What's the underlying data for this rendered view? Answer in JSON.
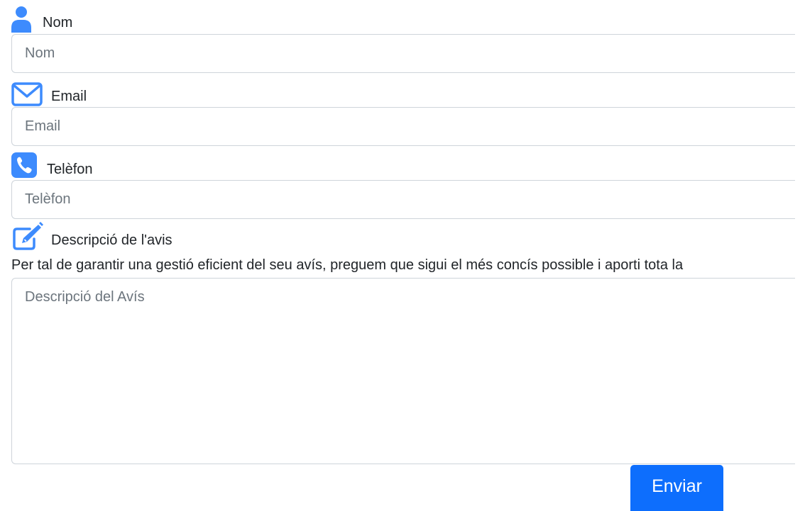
{
  "colors": {
    "accent": "#0d6efd",
    "icon": "#3d8bfd",
    "border": "#ced4da",
    "placeholder": "#6c757d"
  },
  "form": {
    "name": {
      "icon": "person-icon",
      "label": "Nom",
      "placeholder": "Nom",
      "value": ""
    },
    "email": {
      "icon": "envelope-icon",
      "label": "Email",
      "placeholder": "Email",
      "value": ""
    },
    "phone": {
      "icon": "phone-icon",
      "label": "Telèfon",
      "placeholder": "Telèfon",
      "value": ""
    },
    "description": {
      "icon": "pencil-square-icon",
      "label": "Descripció de l'avis",
      "help": "Per tal de garantir una gestió eficient del seu avís, preguem que sigui el més concís possible i aporti tota la",
      "placeholder": "Descripció del Avís",
      "value": ""
    },
    "submit_label": "Enviar"
  }
}
